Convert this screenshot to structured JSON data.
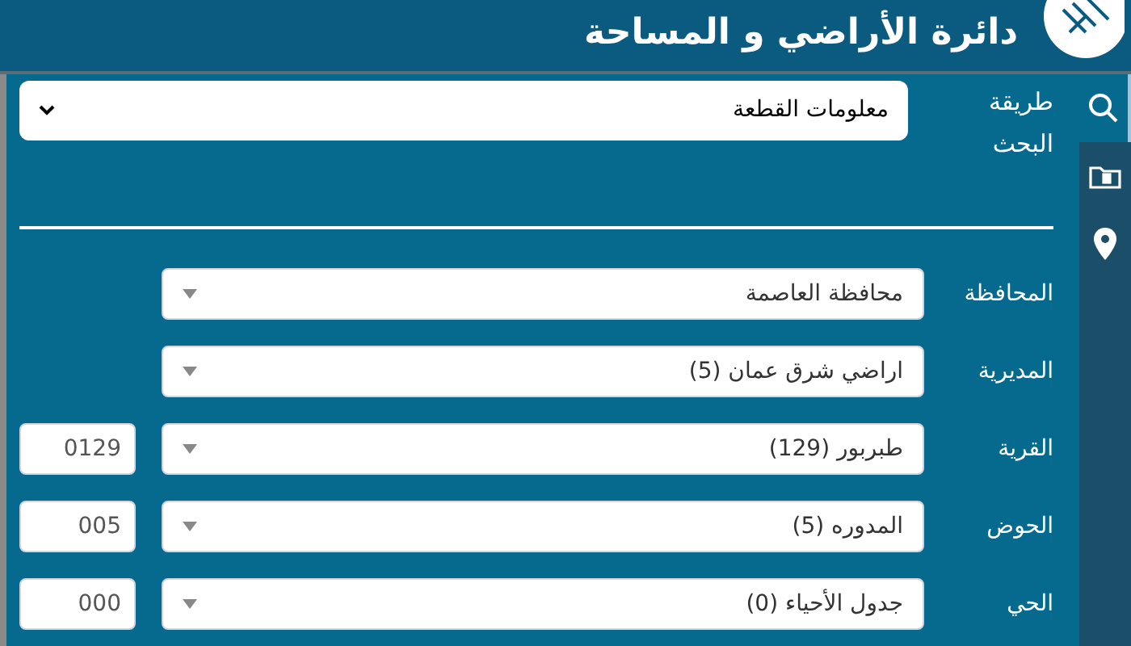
{
  "header": {
    "title": "دائرة الأراضي و المساحة"
  },
  "sidebar": {
    "items": [
      {
        "kind": "search",
        "selected": true
      },
      {
        "kind": "folder",
        "selected": false
      },
      {
        "kind": "pin",
        "selected": false
      }
    ]
  },
  "search_method": {
    "label": "طريقة البحث",
    "value": "معلومات القطعة"
  },
  "fields": [
    {
      "label": "المحافظة",
      "value": "محافظة العاصمة"
    },
    {
      "label": "المديرية",
      "value": "اراضي شرق عمان (5)"
    },
    {
      "label": "القرية",
      "value": "طبربور (129)",
      "code": "0129"
    },
    {
      "label": "الحوض",
      "value": "المدوره (5)",
      "code": "005"
    },
    {
      "label": "الحي",
      "value": "جدول الأحياء (0)",
      "code": "000"
    }
  ]
}
